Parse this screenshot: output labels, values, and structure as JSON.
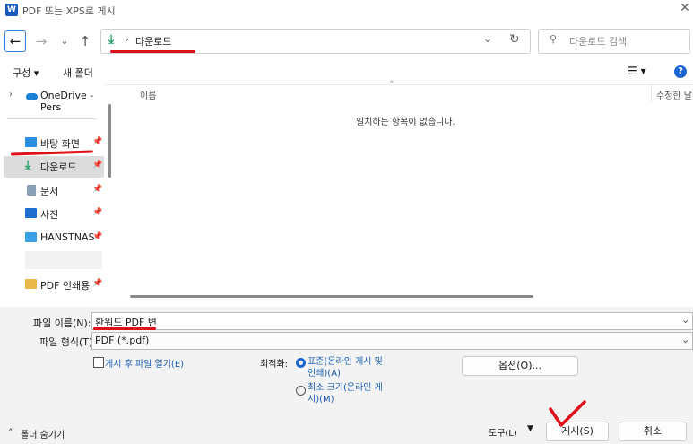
{
  "window": {
    "title": "PDF 또는 XPS로 게시",
    "app_icon": "W"
  },
  "nav": {
    "breadcrumb_current": "다운로드",
    "search_placeholder": "다운로드 검색"
  },
  "toolbar": {
    "organize": "구성 ▾",
    "new_folder": "새 폴더"
  },
  "sidebar": {
    "items": [
      {
        "label": "OneDrive - Pers",
        "icon": "cloud-icon"
      },
      {
        "label": "바탕 화면",
        "icon": "desktop-icon"
      },
      {
        "label": "다운로드",
        "icon": "download-icon"
      },
      {
        "label": "문서",
        "icon": "document-icon"
      },
      {
        "label": "사진",
        "icon": "picture-icon"
      },
      {
        "label": "HANSTNAS",
        "icon": "drive-icon"
      },
      {
        "label": "PDF 인쇄용",
        "icon": "folder-icon"
      }
    ]
  },
  "content": {
    "col_name": "이름",
    "col_modified": "수정한 날",
    "empty_message": "일치하는 항목이 없습니다."
  },
  "bottom": {
    "filename_label": "파일 이름(N):",
    "filename_value": "환워드 PDF 변",
    "filetype_label": "파일 형식(T):",
    "filetype_value": "PDF (*.pdf)",
    "open_after": "게시 후 파일 열기(E)",
    "optimize_label": "최적화:",
    "opt_standard": "표준(온라인 게시 및\n인쇄)(A)",
    "opt_minimum": "최소 크기(온라인 게\n시)(M)",
    "options_button": "옵션(O)...",
    "hide_folders": "폴더 숨기기",
    "tools": "도구(L)",
    "publish": "게시(S)",
    "cancel": "취소"
  },
  "colors": {
    "accent": "#1a66d1",
    "annotation": "#e0101a",
    "download_green": "#2aa36b"
  }
}
